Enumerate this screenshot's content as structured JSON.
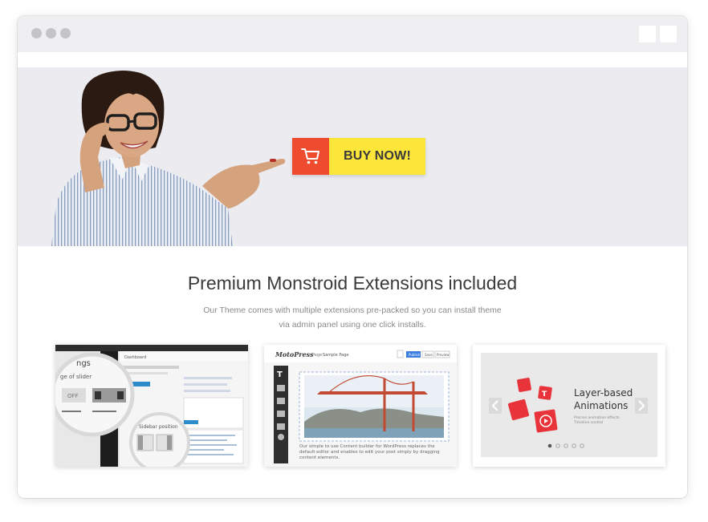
{
  "hero": {
    "buy_label": "BUY NOW!",
    "cart_icon": "cart-icon",
    "colors": {
      "cart_bg": "#ef4b2f",
      "button_bg": "#fde63a",
      "hero_bg": "#ececf0"
    }
  },
  "section": {
    "title": "Premium Monstroid Extensions included",
    "subtitle_line1": "Our Theme comes with multiple extensions pre-packed so you can install theme",
    "subtitle_line2": "via admin panel using one click installs."
  },
  "cards": [
    {
      "id": "wp-admin",
      "labels": {
        "magnifier_title": "ngs",
        "magnifier_sub": "ge of slider",
        "off": "OFF",
        "small_magnifier": "Sidebar position",
        "tab": "Dashboard"
      }
    },
    {
      "id": "motopress",
      "logo": "MotoPress",
      "page_label": "Page:",
      "page_name": "Sample Page",
      "buttons": [
        "Publish",
        "Save",
        "Preview"
      ],
      "caption": "Our simple to use Content builder for WordPress replaces the default editor and enables to edit your post simply by dragging content elements."
    },
    {
      "id": "layer-slider",
      "heading_line1": "Layer-based",
      "heading_line2": "Animations",
      "sub_line1": "Precise animation effects",
      "sub_line2": "Timeline control",
      "prev_icon": "chevron-left-icon",
      "next_icon": "chevron-right-icon",
      "accent": "#e8333a"
    }
  ]
}
